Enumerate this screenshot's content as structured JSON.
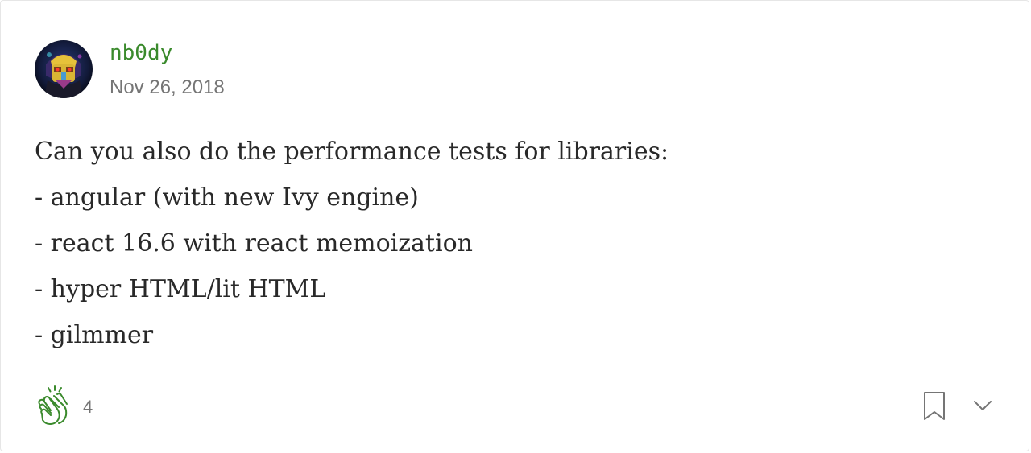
{
  "comment": {
    "author": "nb0dy",
    "date": "Nov 26, 2018",
    "lines": [
      "Can you also do the performance tests for libraries:",
      "- angular (with new Ivy engine)",
      "- react 16.6 with react memoization",
      "- hyper HTML/lit HTML",
      "- gilmmer"
    ]
  },
  "actions": {
    "clap_count": "4",
    "clap_icon": "clap-icon",
    "bookmark_icon": "bookmark-icon",
    "more_icon": "chevron-down-icon"
  },
  "colors": {
    "author": "#3a8a2c",
    "clap": "#3a8a2c",
    "muted": "#757575",
    "text": "#292929",
    "border": "#e6e6e6"
  }
}
